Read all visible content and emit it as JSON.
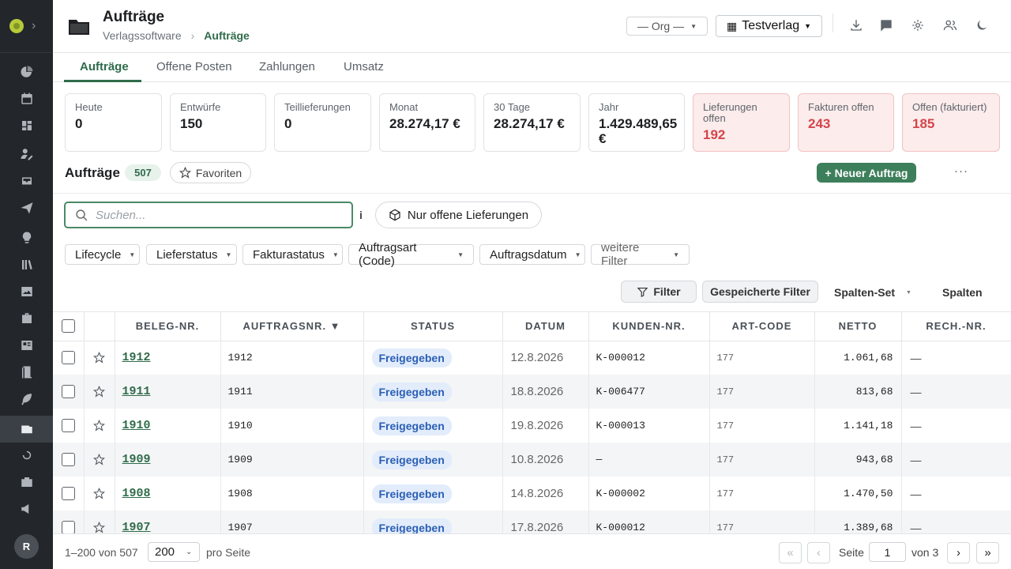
{
  "sidebar": {
    "avatar_initial": "R",
    "icons": [
      "chart-icon",
      "calendar-icon",
      "dashboard-icon",
      "users-edit-icon",
      "inbox-icon",
      "send-icon",
      "lightbulb-icon",
      "library-icon",
      "image-icon",
      "briefcase-icon",
      "layout-icon",
      "book-icon",
      "feather-icon",
      "orders-icon",
      "sync-icon",
      "case-icon",
      "megaphone-icon"
    ],
    "active": "orders-icon"
  },
  "header": {
    "title": "Aufträge",
    "breadcrumb": [
      "Verlagssoftware",
      "Aufträge"
    ],
    "org_select": "— Org —",
    "verlag_select": "Testverlag"
  },
  "tabs": [
    "Aufträge",
    "Offene Posten",
    "Zahlungen",
    "Umsatz"
  ],
  "kpis": [
    {
      "label": "Heute",
      "value": "0"
    },
    {
      "label": "Entwürfe",
      "value": "150"
    },
    {
      "label": "Teillieferungen",
      "value": "0"
    },
    {
      "label": "Monat",
      "value": "28.274,17 €"
    },
    {
      "label": "30 Tage",
      "value": "28.274,17 €"
    },
    {
      "label": "Jahr",
      "value": "1.429.489,65 €"
    },
    {
      "label": "Lieferungen offen",
      "value": "192"
    },
    {
      "label": "Fakturen offen",
      "value": "243"
    },
    {
      "label": "Offen (fakturiert)",
      "value": "185"
    }
  ],
  "list": {
    "title": "Aufträge",
    "count": "507",
    "favorites": "Favoriten",
    "new_button": "+ Neuer Auftrag",
    "more": "···"
  },
  "search": {
    "placeholder": "Suchen...",
    "info": "i",
    "open_deliveries": "Nur offene Lieferungen"
  },
  "filters": [
    "Lifecycle",
    "Lieferstatus",
    "Fakturastatus",
    "Auftragsart (Code)",
    "Auftragsdatum",
    "weitere Filter"
  ],
  "toolbar": {
    "filter": "Filter",
    "saved": "Gespeicherte Filter",
    "column_set": "Spalten-Set",
    "columns": "Spalten"
  },
  "table": {
    "headers": [
      "BELEG-NR.",
      "AUFTRAGSNR. ▼",
      "STATUS",
      "DATUM",
      "KUNDEN-NR.",
      "ART-CODE",
      "NETTO",
      "RECH.-NR."
    ],
    "rows": [
      {
        "beleg": "1912",
        "auftrag": "1912",
        "status": "Freigegeben",
        "datum": "12.8.2026",
        "kunde": "K-000012",
        "art": "177",
        "netto": "1.061,68",
        "rech": "—"
      },
      {
        "beleg": "1911",
        "auftrag": "1911",
        "status": "Freigegeben",
        "datum": "18.8.2026",
        "kunde": "K-006477",
        "art": "177",
        "netto": "813,68",
        "rech": "—"
      },
      {
        "beleg": "1910",
        "auftrag": "1910",
        "status": "Freigegeben",
        "datum": "19.8.2026",
        "kunde": "K-000013",
        "art": "177",
        "netto": "1.141,18",
        "rech": "—"
      },
      {
        "beleg": "1909",
        "auftrag": "1909",
        "status": "Freigegeben",
        "datum": "10.8.2026",
        "kunde": "—",
        "art": "177",
        "netto": "943,68",
        "rech": "—"
      },
      {
        "beleg": "1908",
        "auftrag": "1908",
        "status": "Freigegeben",
        "datum": "14.8.2026",
        "kunde": "K-000002",
        "art": "177",
        "netto": "1.470,50",
        "rech": "—"
      },
      {
        "beleg": "1907",
        "auftrag": "1907",
        "status": "Freigegeben",
        "datum": "17.8.2026",
        "kunde": "K-000012",
        "art": "177",
        "netto": "1.389,68",
        "rech": "—"
      }
    ]
  },
  "pagination": {
    "range": "1–200 von 507",
    "page_size": "200",
    "per_page": "pro Seite",
    "page_label": "Seite",
    "page": "1",
    "of": "von 3",
    "first": "«",
    "prev": "‹",
    "next": "›",
    "last": "»"
  }
}
